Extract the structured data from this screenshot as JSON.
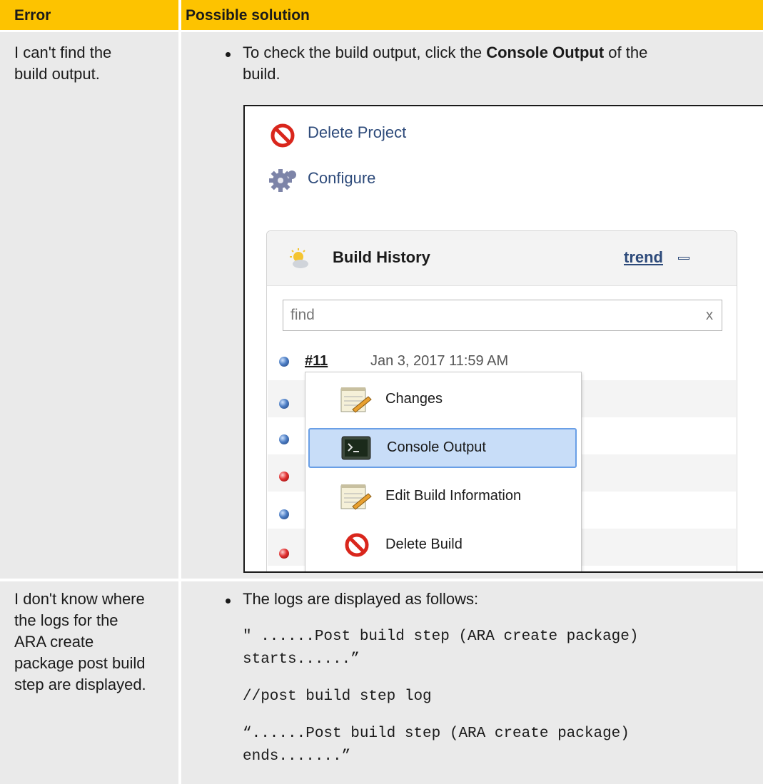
{
  "header": {
    "col1": "Error",
    "col2": "Possible solution"
  },
  "rows": [
    {
      "error_lines": [
        "I can't find the",
        "build output."
      ],
      "solution_pre": "To check the build output, click the ",
      "solution_bold": "Console Output",
      "solution_post": " of the",
      "solution_line2": "build."
    },
    {
      "error_lines": [
        "I don't know where",
        "the logs for the",
        "ARA create",
        "package post build",
        "step are displayed."
      ],
      "solution_intro": "The logs are displayed as follows:",
      "code": [
        "\" ......Post build step (ARA create package)",
        "starts......”",
        "//post build step log",
        "“......Post build step (ARA create package)",
        "ends.......”"
      ]
    }
  ],
  "screenshot": {
    "delete_project": "Delete Project",
    "configure": "Configure",
    "build_history": "Build History",
    "trend": "trend",
    "find_placeholder": "find",
    "find_clear": "x",
    "build_number": "#11",
    "build_date": "Jan 3, 2017 11:59 AM",
    "menu": [
      "Changes",
      "Console Output",
      "Edit Build Information",
      "Delete Build"
    ],
    "ball_colors": [
      "blue",
      "blue",
      "blue",
      "red",
      "blue",
      "red"
    ],
    "colors": {
      "header": "#fdc300",
      "cell": "#eaeaea",
      "link": "#2d4a7a",
      "selected": "#c8ddf8"
    }
  }
}
